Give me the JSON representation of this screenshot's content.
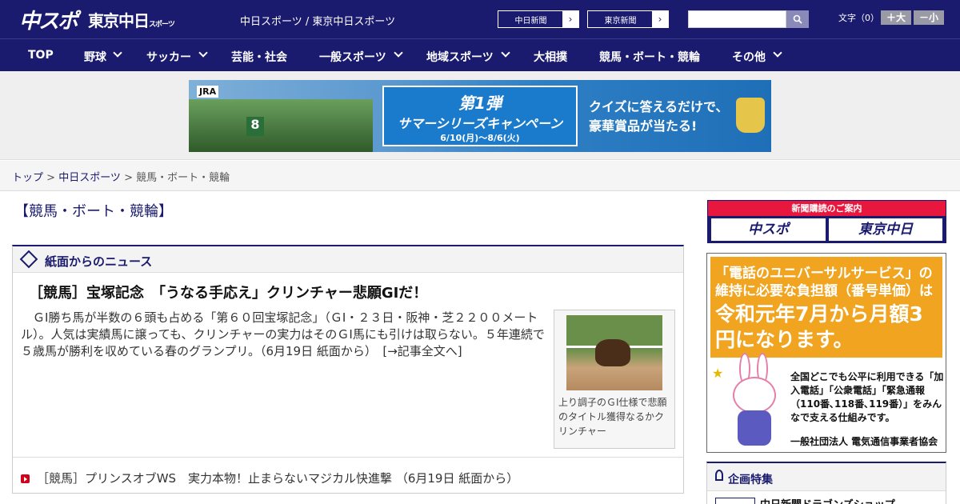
{
  "header": {
    "logo_chuspo": "中スポ",
    "logo_tokyo": "東京中日",
    "logo_tokyo_small": "スポーツ",
    "site_name": "中日スポーツ / 東京中日スポーツ",
    "papers": [
      {
        "label": "中日新聞",
        "arrow": "›"
      },
      {
        "label": "東京新聞",
        "arrow": "›"
      }
    ],
    "search_value": "",
    "font_label": "文字（0）",
    "font_bigger": "＋大",
    "font_smaller": "－小"
  },
  "nav": {
    "items": [
      "TOP",
      "野球",
      "サッカー",
      "芸能・社会",
      "一般スポーツ",
      "地域スポーツ",
      "大相撲",
      "競馬・ボート・競輪",
      "その他"
    ]
  },
  "ad_banner": {
    "brand": "JRA",
    "saddle_number": "8",
    "title_line1": "第1弾",
    "title_line2": "サマーシリーズキャンペーン",
    "dates": "6/10(月)～8/6(火)",
    "copy_line1": "クイズに答えるだけで、",
    "copy_line2": "豪華賞品が当たる!"
  },
  "breadcrumb": {
    "home": "トップ",
    "sep1": " > ",
    "section": "中日スポーツ",
    "sep2": " > ",
    "current": "競馬・ボート・競輪"
  },
  "page_title": "【競馬・ボート・競輪】",
  "news": {
    "header": "紙面からのニュース",
    "headline": "［競馬］宝塚記念　「うなる手応え」クリンチャー悲願GIだ！",
    "body": "　ＧⅠ勝ち馬が半数の６頭も占める「第６０回宝塚記念」（ＧⅠ・２３日・阪神・芝２２００メートル）。人気は実績馬に譲っても、クリンチャーの実力はそのＧⅠ馬にも引けは取らない。５年連続で５歳馬が勝利を収めている春のグランプリ。（6月19日 紙面から）　[→記事全文へ]",
    "photo_caption": "上り調子のＧⅠ仕様で悲願のタイトル獲得なるかクリンチャー",
    "links": [
      "［競馬］プリンスオブWS　実力本物！止まらないマジカル快進撃 （6月19日 紙面から）"
    ]
  },
  "sidebar": {
    "subscribe_title": "新聞購読のご案内",
    "subscribe_a": "中スポ",
    "subscribe_b": "東京中日",
    "universal_line1": "「電話のユニバーサルサービス」の維持に必要な負担額（番号単価）は",
    "universal_line2": "令和元年7月から月額3円になります。",
    "universal_desc": "全国どこでも公平に利用できる「加入電話」「公衆電話」「緊急通報（110番､118番､119番）」をみんなで支える仕組みです。",
    "universal_org": "一般社団法人 電気通信事業者協会",
    "kikaku_title": "企画特集",
    "kikaku_item": "中日新聞ドラゴンズショップ"
  }
}
